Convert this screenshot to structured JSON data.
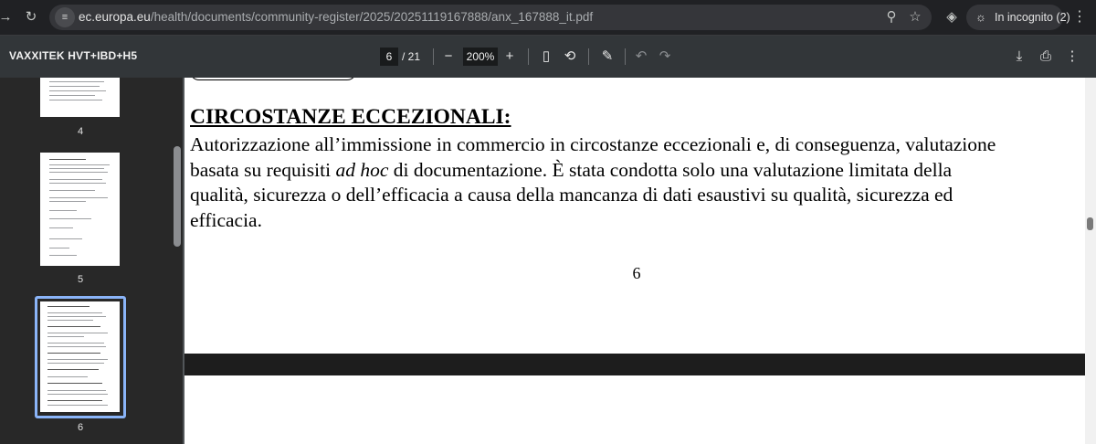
{
  "browser": {
    "url_host": "ec.europa.eu",
    "url_path": "/health/documents/community-register/2025/20251119167888/anx_167888_it.pdf",
    "incognito_label": "In incognito (2)",
    "icons": {
      "back": "arrow-left-icon",
      "reload": "reload-icon",
      "site_info": "tune-icon",
      "zoom": "zoom-icon",
      "bookmark": "star-icon",
      "extension": "extension-icon",
      "incognito": "incognito-icon",
      "menu": "more-vertical-icon"
    }
  },
  "toolbar": {
    "title": "VAXXITEK HVT+IBD+H5",
    "current_page": "6",
    "total_pages": "/ 21",
    "zoom_value": "200%"
  },
  "sidebar": {
    "thumbnails": [
      {
        "label": "4"
      },
      {
        "label": "5"
      },
      {
        "label": "6",
        "selected": true
      }
    ]
  },
  "document": {
    "heading": "CIRCOSTANZE ECCEZIONALI:",
    "line1": "Autorizzazione all’immissione in commercio in circostanze eccezionali e, di conseguenza, valutazione",
    "line2_pre": "basata su requisiti ",
    "line2_italic": "ad hoc",
    "line2_post": " di documentazione. È stata condotta solo una valutazione limitata della",
    "line3": "qualità, sicurezza o dell’efficacia a causa della mancanza di dati esaustivi su qualità, sicurezza ed",
    "line4": "efficacia.",
    "page_number": "6"
  },
  "colors": {
    "chrome_bg": "#202124",
    "toolbar_bg": "#323639",
    "viewer_bg": "#525659",
    "selected_thumb": "#8ab4f8"
  }
}
